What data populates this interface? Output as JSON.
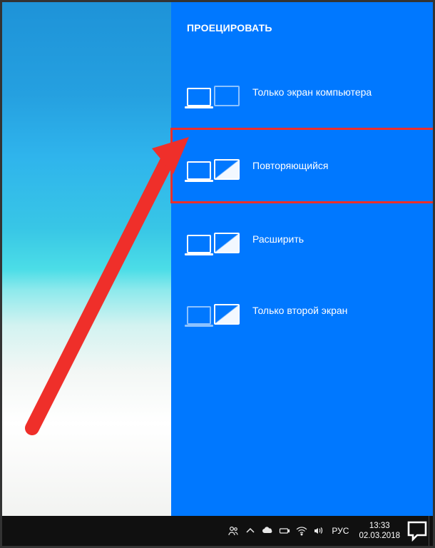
{
  "panel": {
    "title": "ПРОЕЦИРОВАТЬ",
    "options": [
      {
        "id": "pc-only",
        "label": "Только экран компьютера"
      },
      {
        "id": "duplicate",
        "label": "Повторяющийся"
      },
      {
        "id": "extend",
        "label": "Расширить"
      },
      {
        "id": "second-only",
        "label": "Только второй экран"
      }
    ],
    "highlighted_option_index": 1
  },
  "annotation": {
    "arrow_color": "#ef2f2a",
    "highlight_color": "#ef2f2a"
  },
  "taskbar": {
    "language": "РУС",
    "time": "13:33",
    "date": "02.03.2018",
    "icons": [
      "people",
      "chevron-up",
      "onedrive",
      "battery",
      "network",
      "volume"
    ]
  }
}
